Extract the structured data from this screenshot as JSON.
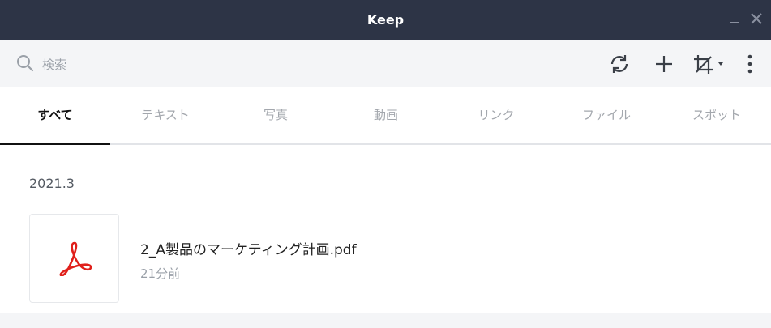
{
  "window": {
    "title": "Keep"
  },
  "colors": {
    "titlebar": "#2d3446",
    "toolbar": "#f4f5f7",
    "pdf_icon": "#e0201b"
  },
  "search": {
    "placeholder": "検索",
    "value": ""
  },
  "toolbar": {
    "icons": [
      "refresh-icon",
      "add-icon",
      "crop-icon",
      "chevron-down-icon",
      "more-vertical-icon"
    ]
  },
  "tabs": [
    {
      "label": "すべて",
      "active": true
    },
    {
      "label": "テキスト",
      "active": false
    },
    {
      "label": "写真",
      "active": false
    },
    {
      "label": "動画",
      "active": false
    },
    {
      "label": "リンク",
      "active": false
    },
    {
      "label": "ファイル",
      "active": false
    },
    {
      "label": "スポット",
      "active": false
    }
  ],
  "content": {
    "date_heading": "2021.3",
    "items": [
      {
        "name": "2_A製品のマーケティング計画.pdf",
        "time": "21分前",
        "icon": "pdf-icon"
      }
    ]
  }
}
